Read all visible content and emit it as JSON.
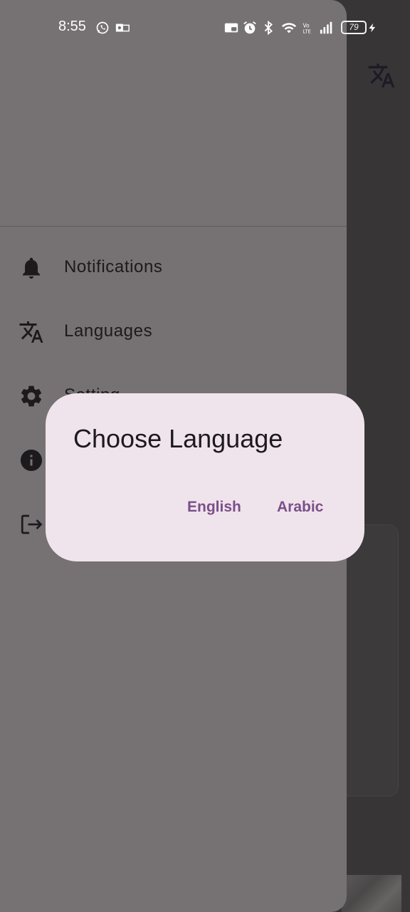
{
  "status_bar": {
    "time": "8:55",
    "battery_level": "79",
    "icons": [
      "whatsapp-icon",
      "outlook-icon",
      "cast-icon",
      "alarm-icon",
      "bluetooth-icon",
      "wifi-icon",
      "volte-icon",
      "signal-icon",
      "battery-icon",
      "charging-icon"
    ]
  },
  "drawer": {
    "items": [
      {
        "label": "Notifications",
        "icon": "bell-icon"
      },
      {
        "label": "Languages",
        "icon": "translate-icon"
      },
      {
        "label": "Setting",
        "icon": "gear-icon"
      },
      {
        "label": "",
        "icon": "info-icon"
      },
      {
        "label": "",
        "icon": "logout-icon"
      }
    ]
  },
  "dialog": {
    "title": "Choose Language",
    "options": [
      "English",
      "Arabic"
    ]
  },
  "colors": {
    "drawer_bg": "#767173",
    "dialog_bg": "#f0e4ec",
    "accent": "#7a4f8a"
  }
}
